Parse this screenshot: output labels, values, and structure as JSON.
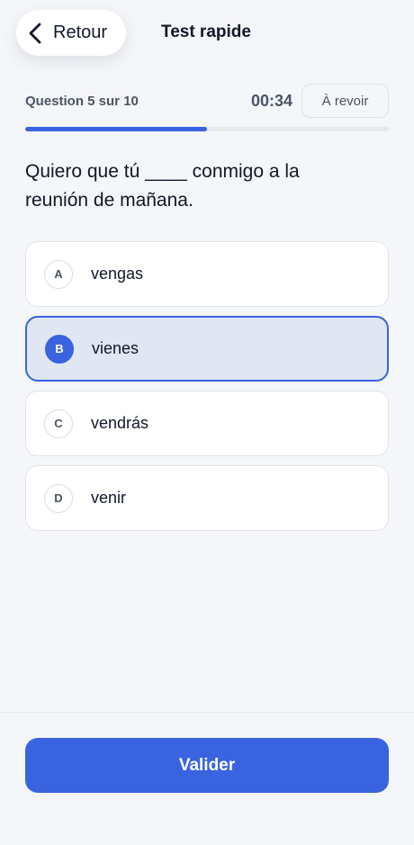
{
  "header": {
    "back_label": "Retour",
    "back_icon": "chevron-left-icon",
    "title": "Test rapide"
  },
  "progress": {
    "counter": "Question 5 sur 10",
    "fraction": 0.5,
    "timer": "00:34",
    "review_label": "À revoir"
  },
  "question": {
    "text": "Quiero que tú ____ conmigo a la reunión de mañana."
  },
  "options": [
    {
      "letter": "A",
      "text": "vengas",
      "selected": false
    },
    {
      "letter": "B",
      "text": "vienes",
      "selected": true
    },
    {
      "letter": "C",
      "text": "vendrás",
      "selected": false
    },
    {
      "letter": "D",
      "text": "venir",
      "selected": false
    }
  ],
  "footer": {
    "submit_label": "Valider"
  },
  "colors": {
    "accent": "#3a63df",
    "selected_bg": "#e0e6f2",
    "background": "#f4f6fa"
  }
}
